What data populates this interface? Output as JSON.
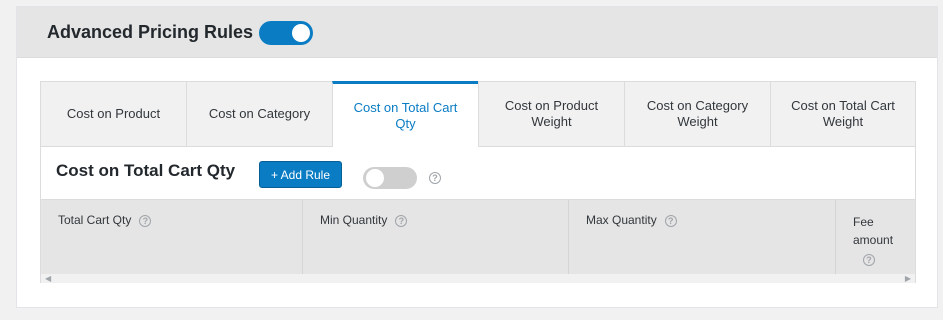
{
  "header": {
    "title": "Advanced Pricing Rules",
    "toggle_on": true
  },
  "tabs": [
    {
      "label": "Cost on Product",
      "active": false
    },
    {
      "label": "Cost on Category",
      "active": false
    },
    {
      "label": "Cost on Total Cart Qty",
      "active": true
    },
    {
      "label": "Cost on Product Weight",
      "active": false
    },
    {
      "label": "Cost on Category Weight",
      "active": false
    },
    {
      "label": "Cost on Total Cart Weight",
      "active": false
    }
  ],
  "section": {
    "title": "Cost on Total Cart Qty",
    "add_rule_label": "+ Add Rule",
    "toggle_on": false,
    "help_glyph": "?"
  },
  "table": {
    "columns": [
      "Total Cart Qty",
      "Min Quantity",
      "Max Quantity",
      "Fee amount"
    ],
    "help_glyph": "?"
  },
  "scrollbar": {
    "left_glyph": "◀",
    "right_glyph": "▶"
  },
  "colors": {
    "accent": "#0a7cc4",
    "header_bg": "#e5e5e5",
    "toggle_off": "#cfcfcf"
  }
}
